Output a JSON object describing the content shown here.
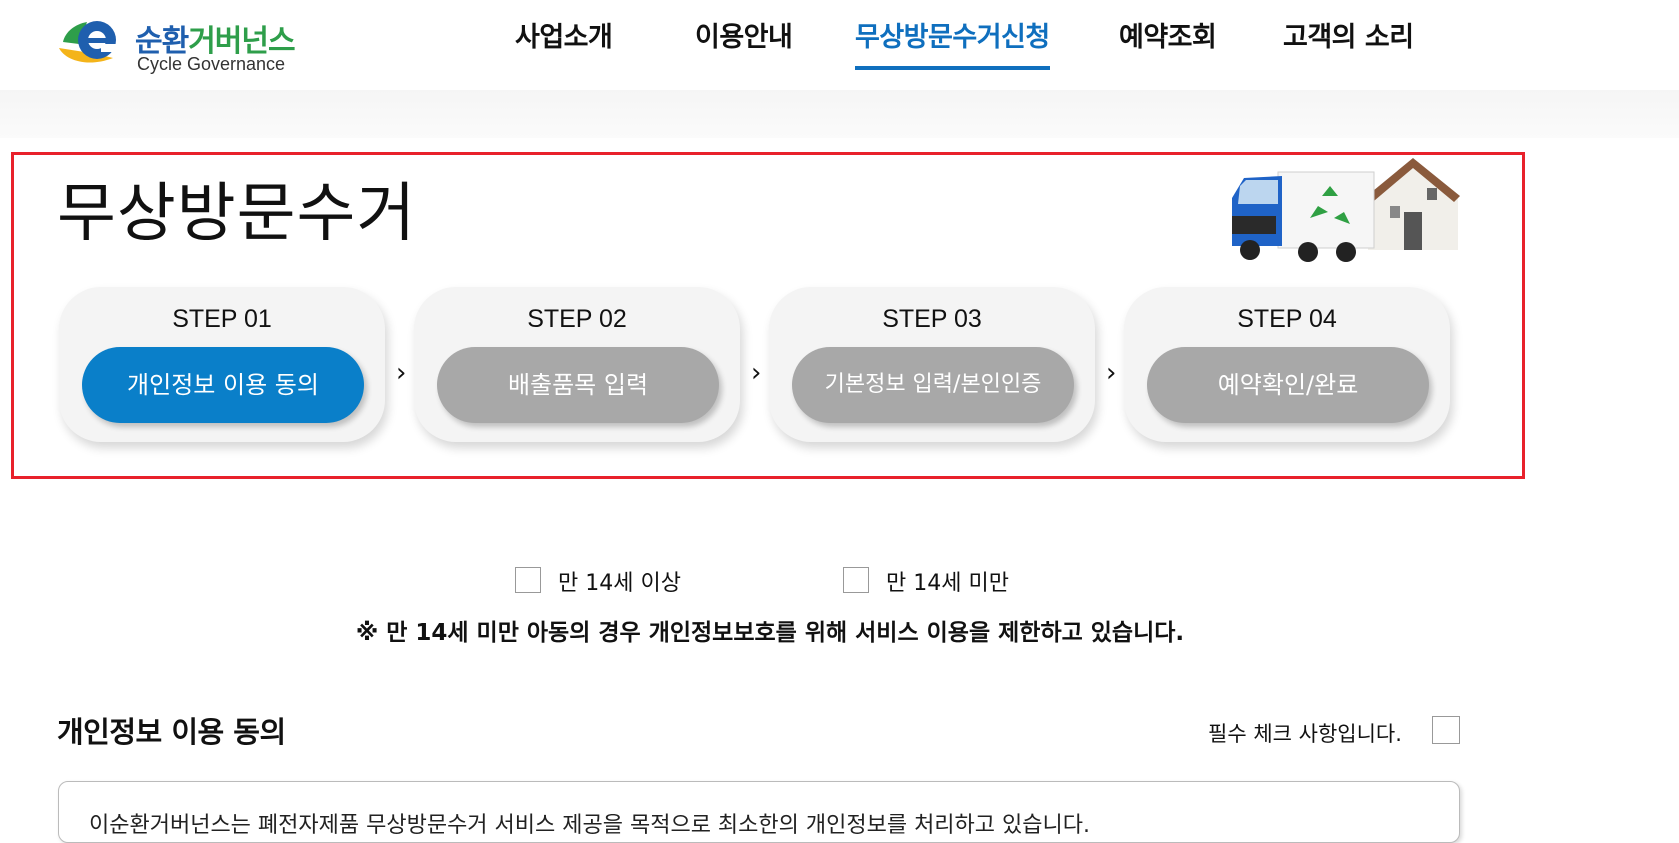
{
  "brand": {
    "name_part1": "순환",
    "name_part2": "거버넌스",
    "name_en": "Cycle Governance"
  },
  "nav": {
    "items": [
      {
        "label": "사업소개"
      },
      {
        "label": "이용안내"
      },
      {
        "label": "무상방문수거신청",
        "active": true
      },
      {
        "label": "예약조회"
      },
      {
        "label": "고객의 소리"
      }
    ]
  },
  "page": {
    "title": "무상방문수거"
  },
  "steps": [
    {
      "title": "STEP 01",
      "label": "개인정보 이용 동의",
      "active": true
    },
    {
      "title": "STEP 02",
      "label": "배출품목 입력",
      "active": false
    },
    {
      "title": "STEP 03",
      "label": "기본정보 입력/본인인증",
      "active": false
    },
    {
      "title": "STEP 04",
      "label": "예약확인/완료",
      "active": false
    }
  ],
  "step_arrow": "›",
  "age_check": {
    "over14": "만 14세 이상",
    "under14": "만 14세 미만",
    "notice": "※ 만 14세 미만 아동의 경우 개인정보보호를 위해 서비스 이용을 제한하고 있습니다."
  },
  "consent": {
    "title": "개인정보 이용 동의",
    "required_label": "필수 체크 사항입니다.",
    "body_preview": "이순환거버넌스는 폐전자제품 무상방문수거 서비스 제공을 목적으로 최소한의 개인정보를 처리하고 있습니다."
  },
  "colors": {
    "accent": "#0f6fbe",
    "step_active": "#0a7fc9",
    "step_inactive": "#a8a8a8",
    "highlight_border": "#e8212b"
  }
}
